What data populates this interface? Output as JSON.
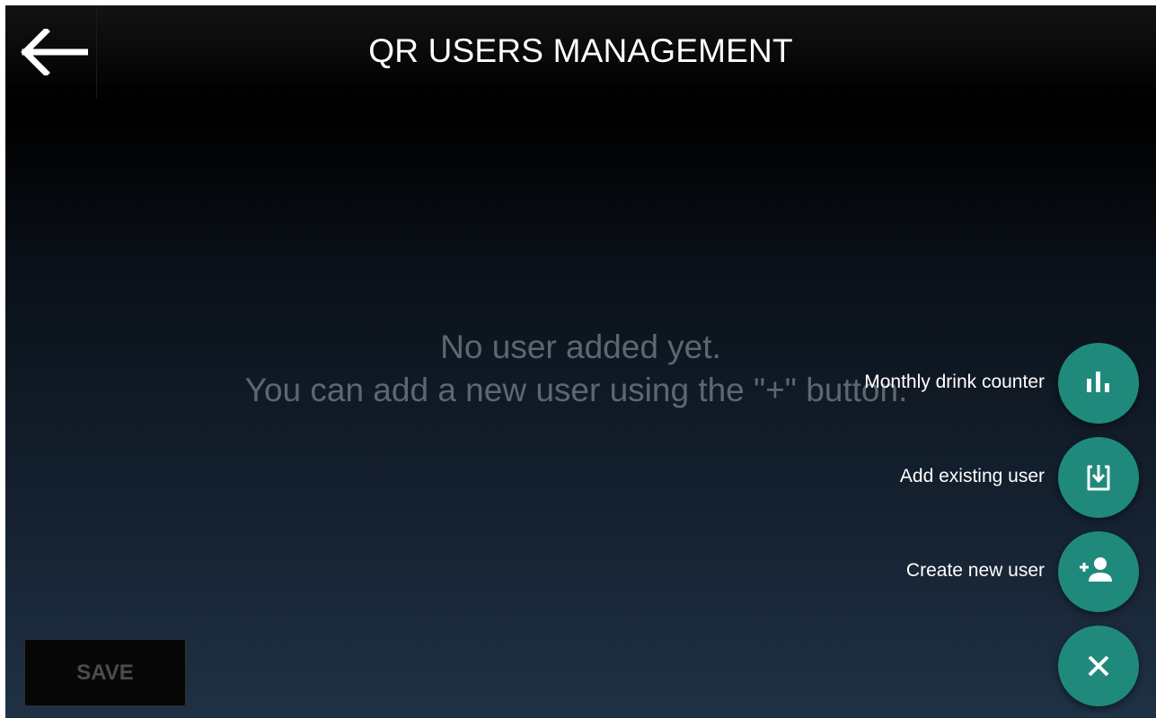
{
  "header": {
    "title": "QR USERS MANAGEMENT",
    "back_icon": "arrow-left-icon"
  },
  "empty_state": {
    "line1": "No user added yet.",
    "line2": "You can add a new user using the \"+\" button."
  },
  "fab_menu": {
    "items": [
      {
        "label": "Monthly drink counter",
        "icon": "bar-chart-icon"
      },
      {
        "label": "Add existing user",
        "icon": "import-icon"
      },
      {
        "label": "Create new user",
        "icon": "add-person-icon"
      }
    ],
    "close_icon": "close-icon",
    "color": "#1f8a7b"
  },
  "footer": {
    "save_label": "SAVE"
  }
}
